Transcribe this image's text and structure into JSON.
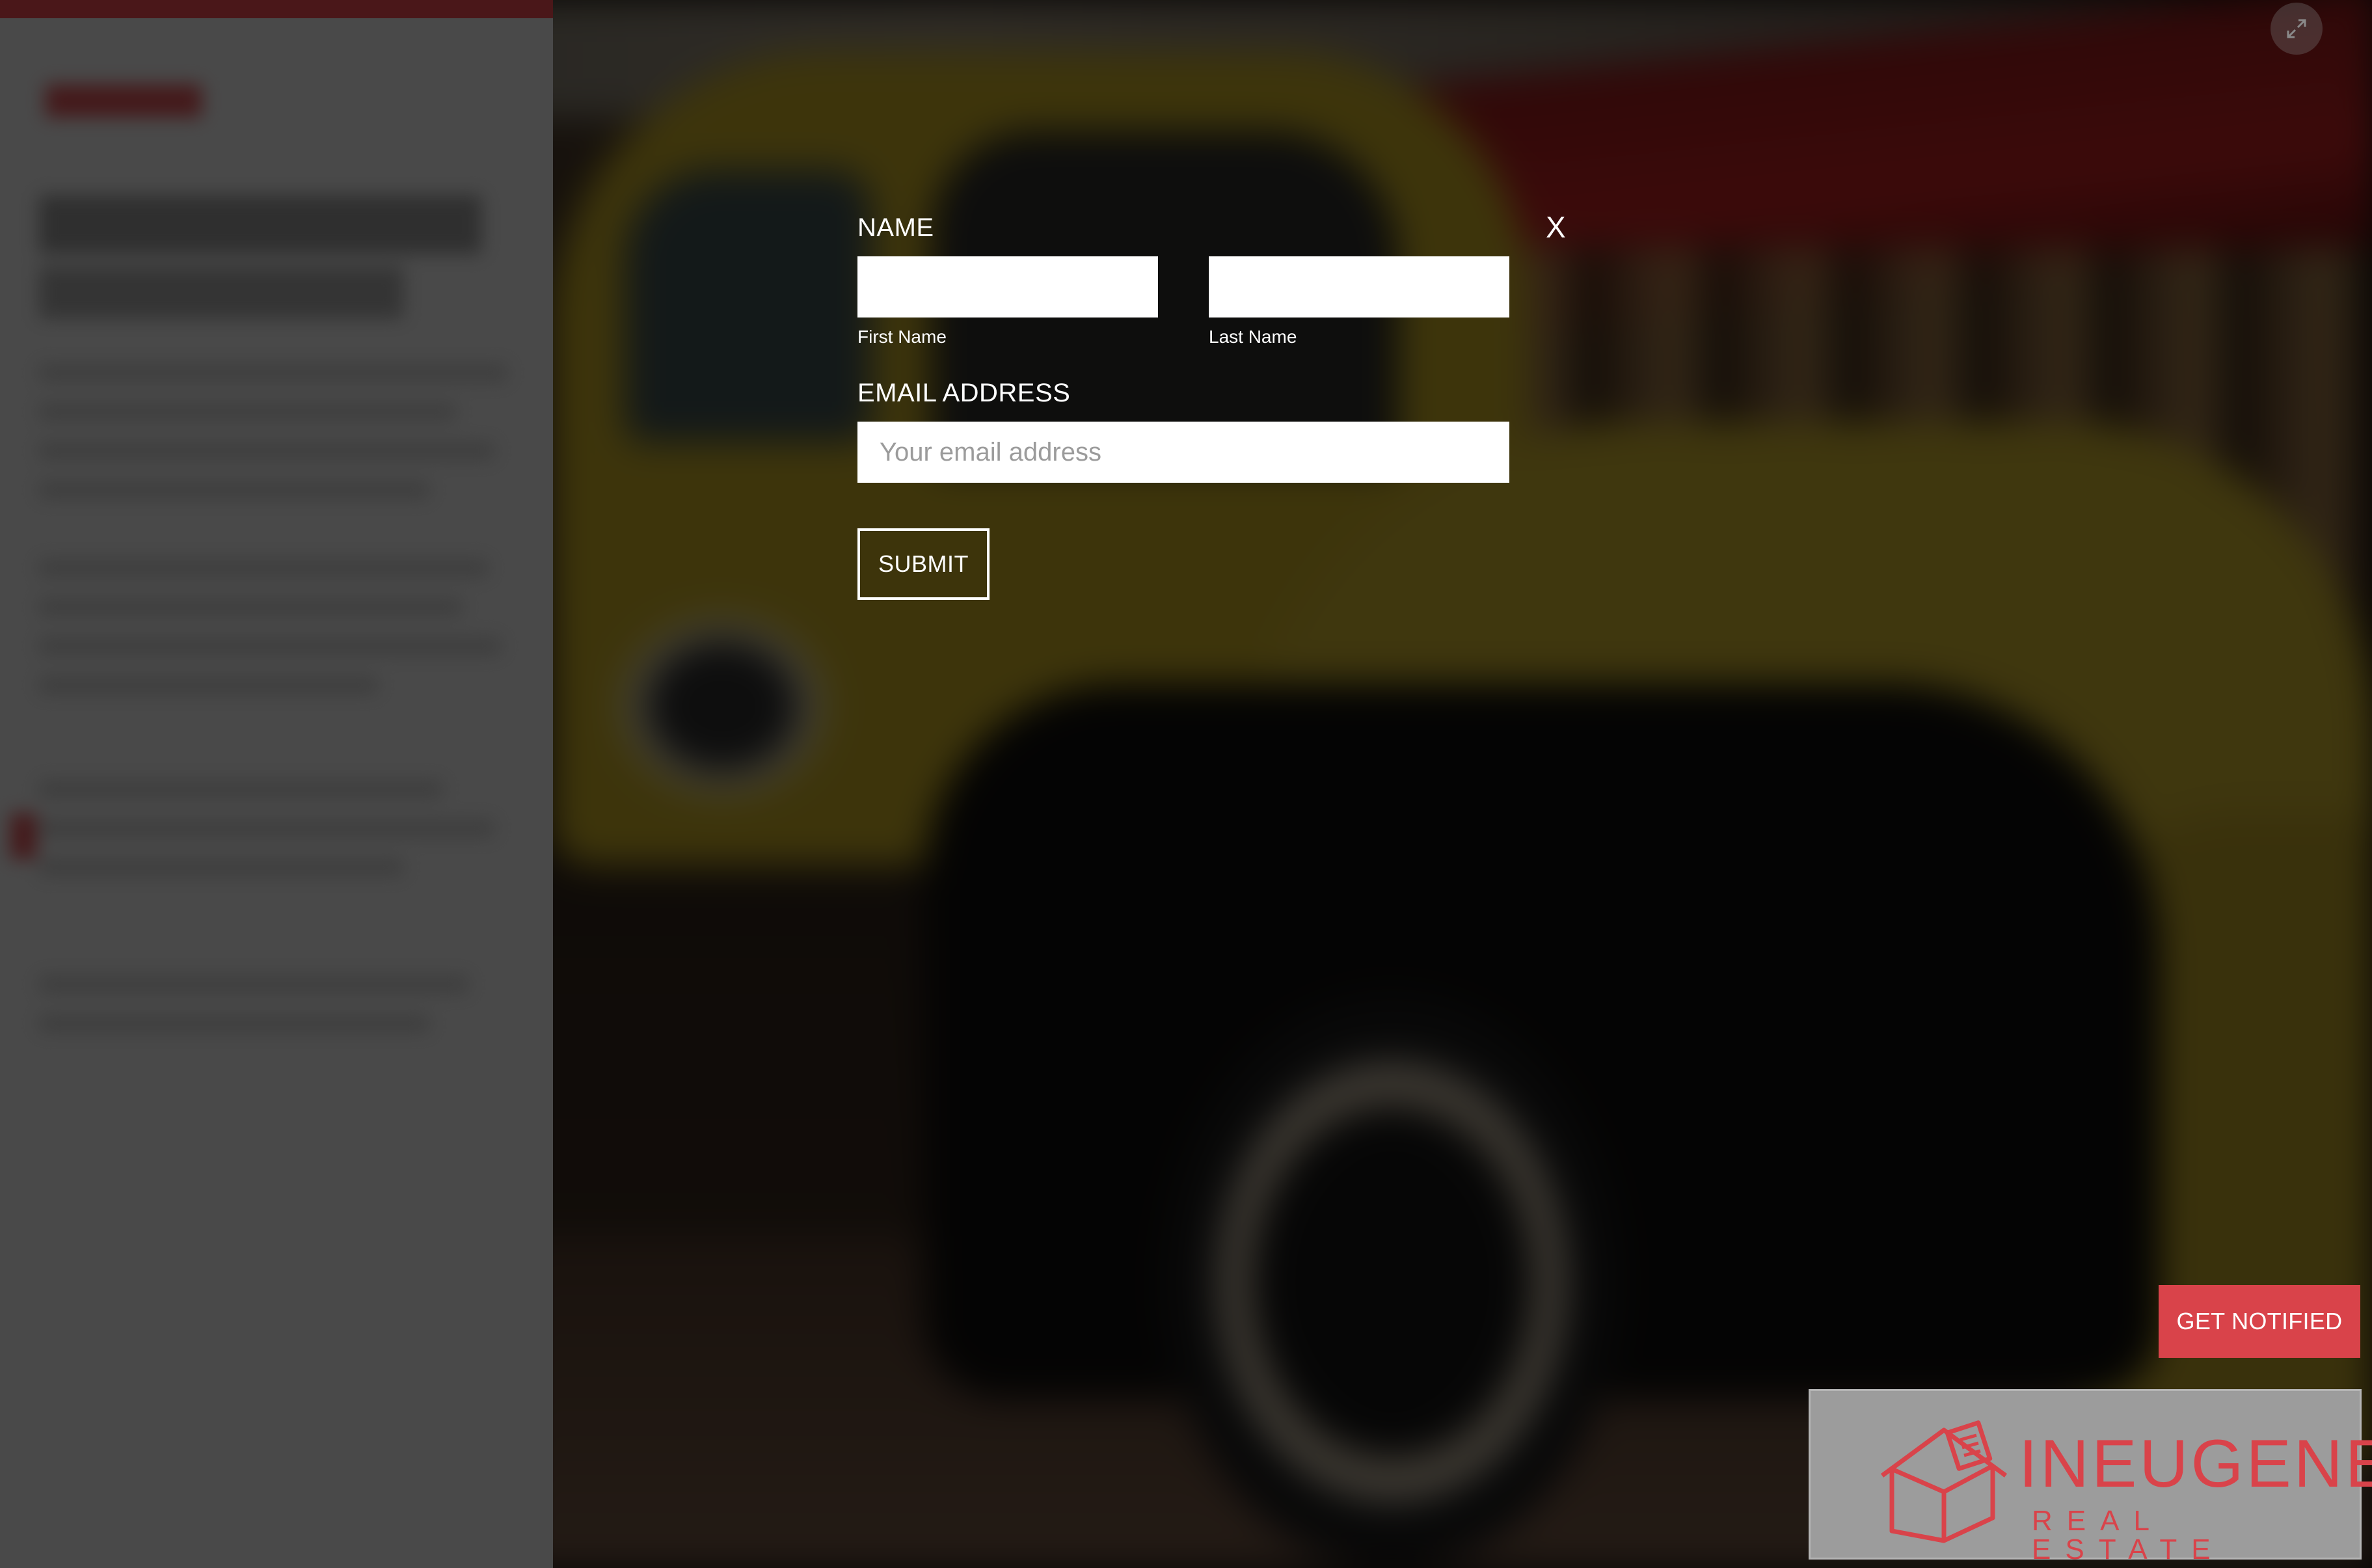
{
  "form": {
    "name_heading": "NAME",
    "first_name_label": "First Name",
    "last_name_label": "Last Name",
    "first_name_value": "",
    "last_name_value": "",
    "email_heading": "EMAIL ADDRESS",
    "email_placeholder": "Your email address",
    "email_value": "",
    "submit_label": "SUBMIT",
    "close_label": "X"
  },
  "cta": {
    "get_notified_label": "GET NOTIFIED"
  },
  "logo": {
    "line1": "INEUGENE",
    "line2": "REAL ESTATE"
  },
  "icons": {
    "fullscreen": "expand-icon",
    "logo": "house-logo-icon"
  },
  "colors": {
    "accent": "#d9434a",
    "overlay": "rgba(0,0,0,0.66)",
    "input_bg": "#ffffff",
    "text": "#ffffff"
  }
}
